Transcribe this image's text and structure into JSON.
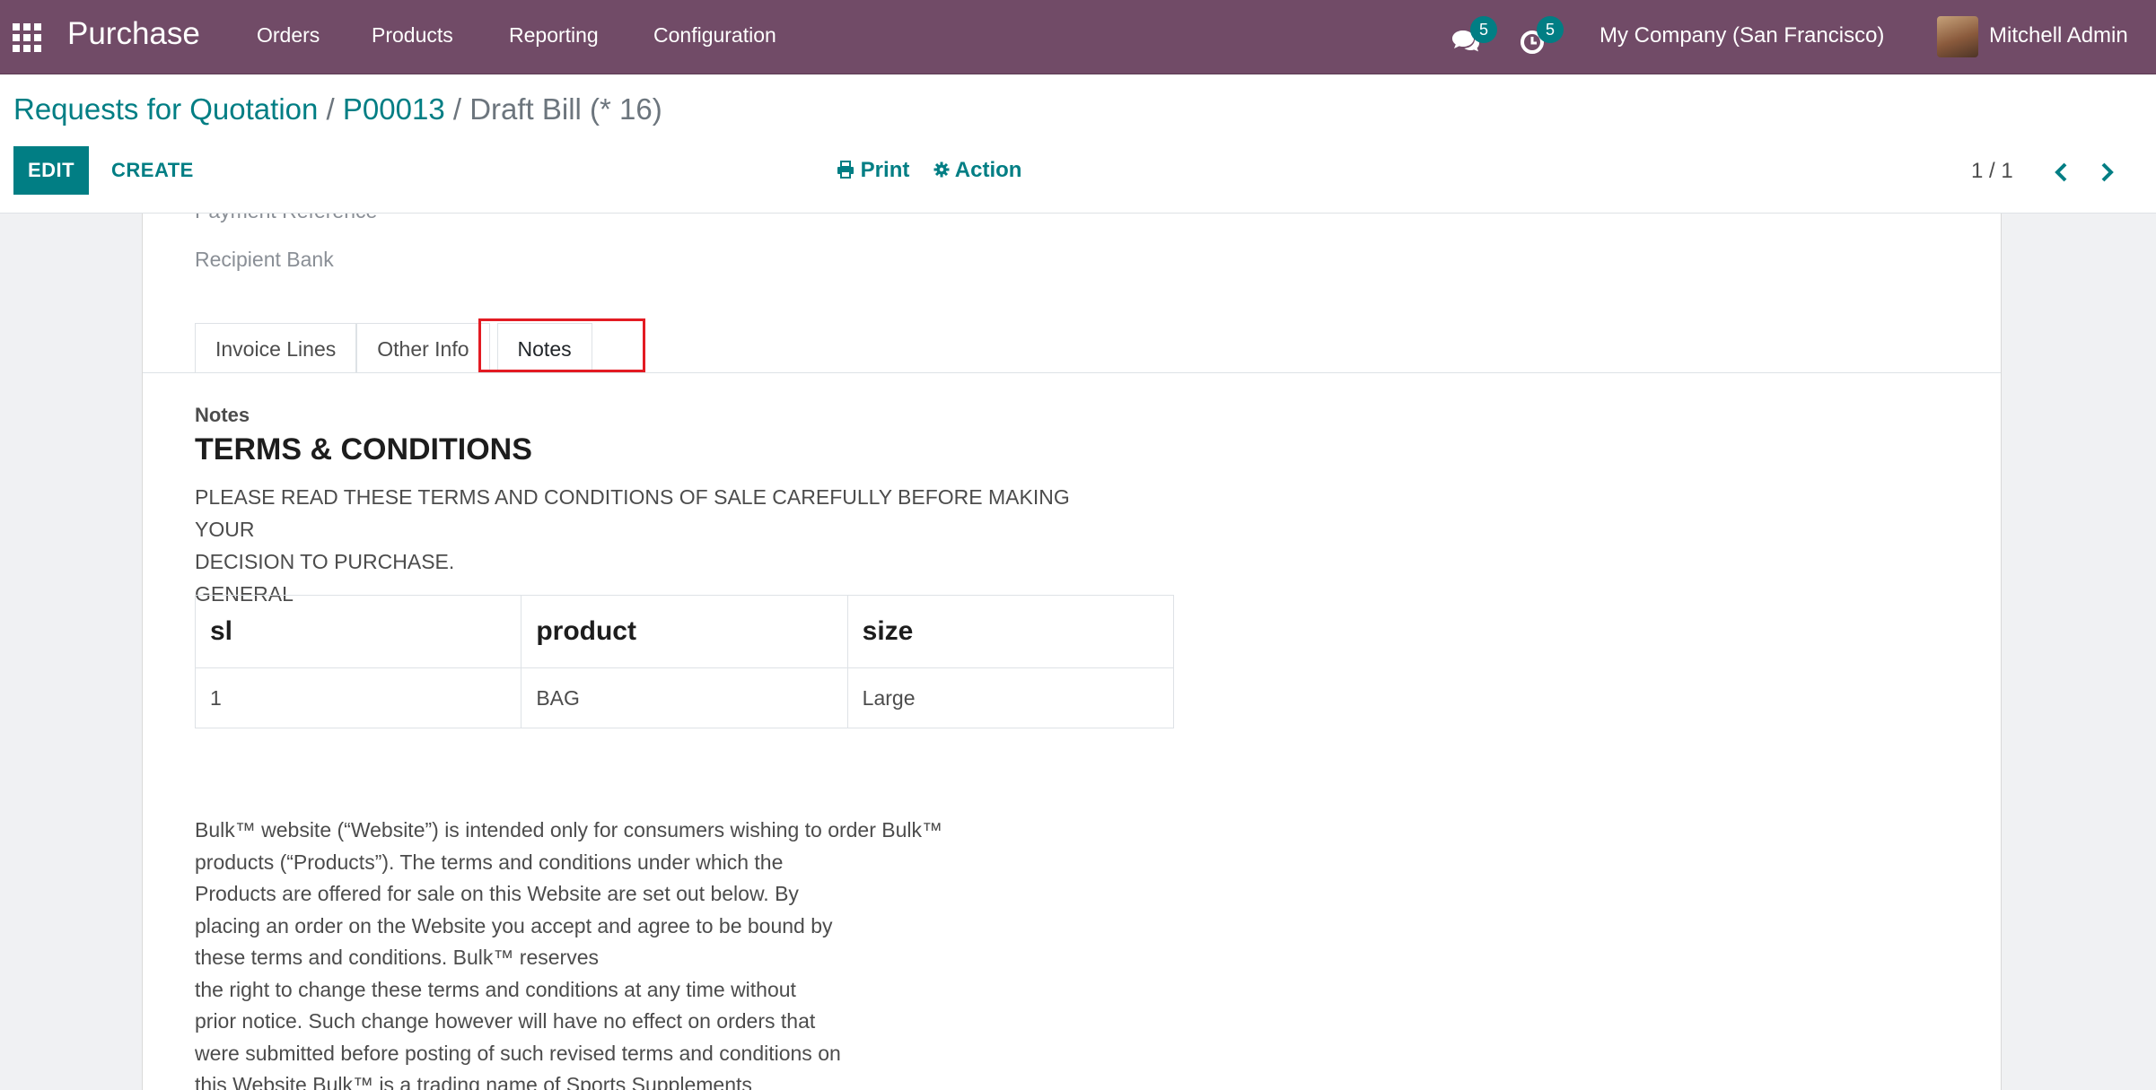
{
  "navbar": {
    "app_name": "Purchase",
    "menus": [
      "Orders",
      "Products",
      "Reporting",
      "Configuration"
    ],
    "messages_badge": "5",
    "activities_badge": "5",
    "company": "My Company (San Francisco)",
    "user": "Mitchell Admin"
  },
  "breadcrumb": {
    "items": [
      "Requests for Quotation",
      "P00013"
    ],
    "separator": "/",
    "active": "Draft Bill (* 16)"
  },
  "buttons": {
    "edit": "EDIT",
    "create": "CREATE",
    "print": "Print",
    "action": "Action"
  },
  "pager": {
    "value": "1 / 1"
  },
  "form": {
    "payment_reference_label": "Payment Reference",
    "recipient_bank_label": "Recipient Bank",
    "tabs": [
      "Invoice Lines",
      "Other Info",
      "Notes"
    ],
    "active_tab": "Notes"
  },
  "notes": {
    "label": "Notes",
    "title": "TERMS & CONDITIONS",
    "intro_lines": [
      "PLEASE READ THESE TERMS AND CONDITIONS OF SALE CAREFULLY BEFORE MAKING YOUR",
      "DECISION TO PURCHASE.",
      "GENERAL"
    ],
    "table": {
      "headers": [
        "sl",
        "product",
        "size"
      ],
      "rows": [
        [
          "1",
          "BAG",
          "Large"
        ]
      ]
    },
    "paragraph_lines": [
      "Bulk™ website (“Website”) is intended only for consumers wishing to order Bulk™",
      "products (“Products”). The terms and conditions under which the",
      "Products are offered for sale on this Website are set out below. By",
      "placing an order on the Website you accept and agree to be bound by",
      "these terms and conditions. Bulk™ reserves",
      "the right to change these terms and conditions at any time without",
      "prior notice. Such change however will have no effect on orders that",
      "were submitted before posting of such revised terms and conditions on",
      "this Website Bulk™ is a trading name of Sports Supplements"
    ]
  },
  "colors": {
    "navbar": "#714b67",
    "accent": "#017e84",
    "highlight": "#e31b23"
  }
}
